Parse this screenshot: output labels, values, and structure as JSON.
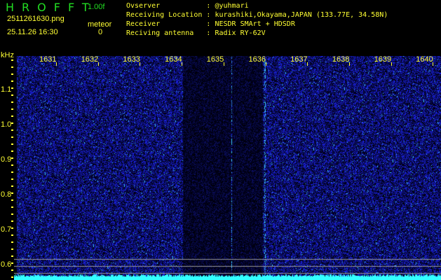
{
  "header": {
    "app_name": "HROFFT",
    "version": "1.00f",
    "filename": "2511261630.png",
    "datetime": "25.11.26 16:30",
    "meteor_label": "meteor",
    "meteor_count": "0"
  },
  "info": [
    {
      "label": "Ovserver          ",
      "value": ": @yuhmari"
    },
    {
      "label": "Receiving Location",
      "value": ": kurashiki,Okayama,JAPAN (133.77E, 34.58N)"
    },
    {
      "label": "Receiver          ",
      "value": ": NESDR SMArt + HDSDR"
    },
    {
      "label": "Reciving antenna  ",
      "value": ": Radix RY-62V"
    }
  ],
  "axis": {
    "y_unit": "kHz",
    "y_ticks": [
      "1.1",
      "1.0",
      "0.9",
      "0.8",
      "0.7",
      "0.6"
    ],
    "x_ticks": [
      "1631",
      "1632",
      "1633",
      "1634",
      "1635",
      "1636",
      "1637",
      "1638",
      "1639",
      "1640"
    ]
  },
  "colors": {
    "text": "#ffff33",
    "logo": "#22dd22",
    "signal": "#2233ff",
    "baseline": "#33ffff"
  }
}
